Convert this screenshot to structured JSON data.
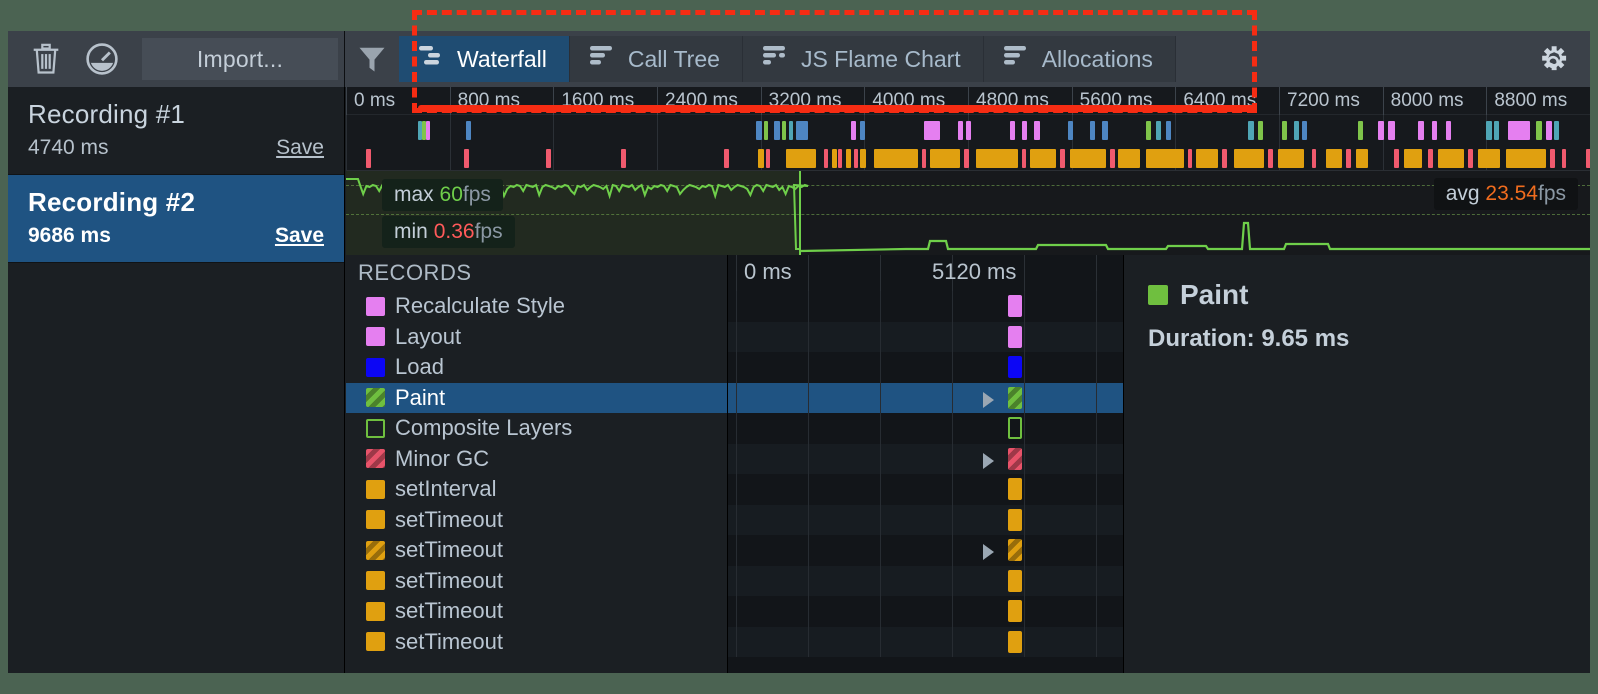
{
  "toolbar": {
    "delete_icon": "trash-icon",
    "record_icon": "gauge-icon",
    "import_label": "Import...",
    "filter_icon": "filter-icon",
    "settings_icon": "gear-icon",
    "tabs": [
      {
        "label": "Waterfall",
        "icon": "waterfall-icon",
        "active": true
      },
      {
        "label": "Call Tree",
        "icon": "call-tree-icon",
        "active": false
      },
      {
        "label": "JS Flame Chart",
        "icon": "flame-chart-icon",
        "active": false
      },
      {
        "label": "Allocations",
        "icon": "allocations-icon",
        "active": false
      }
    ]
  },
  "sidebar": {
    "recordings": [
      {
        "title": "Recording #1",
        "duration": "4740 ms",
        "save_label": "Save",
        "selected": false
      },
      {
        "title": "Recording #2",
        "duration": "9686 ms",
        "save_label": "Save",
        "selected": true
      }
    ]
  },
  "ruler": {
    "ticks": [
      "0 ms",
      "800 ms",
      "1600 ms",
      "2400 ms",
      "3200 ms",
      "4000 ms",
      "4800 ms",
      "5600 ms",
      "6400 ms",
      "7200 ms",
      "8000 ms",
      "8800 ms"
    ]
  },
  "fps_overview": {
    "max_badge": {
      "prefix": "max",
      "value": "60",
      "unit": "fps"
    },
    "min_badge": {
      "prefix": "min",
      "value": "0.36",
      "unit": "fps"
    },
    "avg_badge": {
      "prefix": "avg",
      "value": "23.54",
      "unit": "fps"
    }
  },
  "records": {
    "header": "RECORDS",
    "chart_ticks": [
      "0 ms",
      "5120 ms"
    ],
    "rows": [
      {
        "label": "Recalculate Style",
        "color": "#e57ff0",
        "style": "solid",
        "selected": false,
        "expandable": false
      },
      {
        "label": "Layout",
        "color": "#e57ff0",
        "style": "solid",
        "selected": false,
        "expandable": false
      },
      {
        "label": "Load",
        "color": "#0c06f5",
        "style": "solid",
        "selected": false,
        "expandable": false
      },
      {
        "label": "Paint",
        "color": "#6fbf3f",
        "style": "striped",
        "selected": true,
        "expandable": true
      },
      {
        "label": "Composite Layers",
        "color": "#6fbf3f",
        "style": "outline",
        "selected": false,
        "expandable": false
      },
      {
        "label": "Minor GC",
        "color": "#e8536a",
        "style": "striped",
        "selected": false,
        "expandable": true
      },
      {
        "label": "setInterval",
        "color": "#e0a010",
        "style": "solid",
        "selected": false,
        "expandable": false
      },
      {
        "label": "setTimeout",
        "color": "#e0a010",
        "style": "solid",
        "selected": false,
        "expandable": false
      },
      {
        "label": "setTimeout",
        "color": "#e0a010",
        "style": "striped",
        "selected": false,
        "expandable": true
      },
      {
        "label": "setTimeout",
        "color": "#e0a010",
        "style": "solid",
        "selected": false,
        "expandable": false
      },
      {
        "label": "setTimeout",
        "color": "#e0a010",
        "style": "solid",
        "selected": false,
        "expandable": false
      },
      {
        "label": "setTimeout",
        "color": "#e0a010",
        "style": "solid",
        "selected": false,
        "expandable": false
      }
    ]
  },
  "detail": {
    "name": "Paint",
    "color": "#6fbf3f",
    "duration": "Duration: 9.65 ms"
  },
  "colors": {
    "accent": "#1f5382",
    "annotation": "#f62c13",
    "page_background": "#4b6352",
    "panel": "#1b1f23",
    "toolbar": "#3b4149"
  }
}
